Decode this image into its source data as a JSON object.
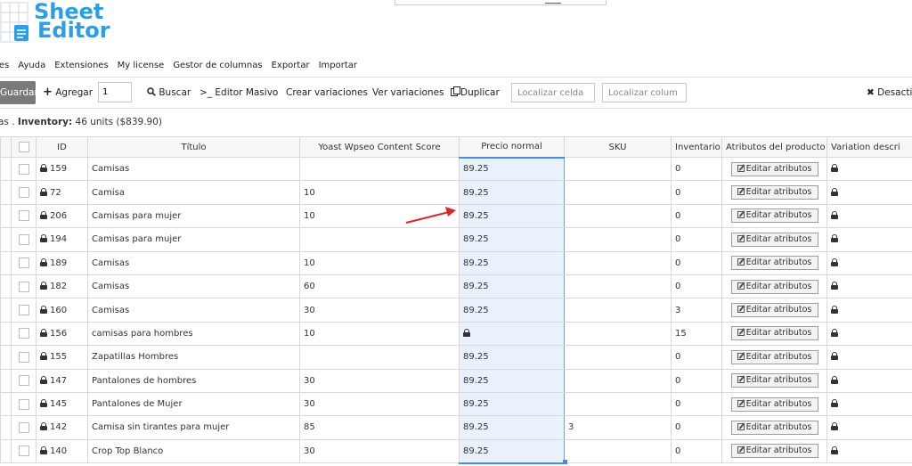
{
  "logo": {
    "line1": "Sheet",
    "line2": "Editor"
  },
  "menu": [
    "tes",
    "Ayuda",
    "Extensiones",
    "My license",
    "Gestor de columnas",
    "Exportar",
    "Importar"
  ],
  "toolbar": {
    "save_label": "Guardar",
    "add_label": "Agregar",
    "add_count": "1",
    "search_label": "Buscar",
    "bulk_edit_label": "Editor Masivo",
    "create_variations_label": "Crear variaciones",
    "view_variations_label": "Ver variaciones",
    "duplicate_label": "Duplicar",
    "find_cell_placeholder": "Localizar celda",
    "find_column_placeholder": "Localizar colum",
    "deactivate_label": "Desactiv"
  },
  "summary": {
    "prefix": "as . ",
    "inventory_label": "Inventory:",
    "inventory_value": " 46 units ($839.90)"
  },
  "columns": {
    "id": "ID",
    "title": "Título",
    "yoast": "Yoast Wpseo Content Score",
    "price": "Precio normal",
    "sku": "SKU",
    "inventory": "Inventario",
    "attributes": "Atributos del producto",
    "variation": "Variation descri"
  },
  "edit_attr_label": "Editar atributos",
  "rows": [
    {
      "id": "159",
      "title": "Camisas",
      "yoast": "",
      "price": "89.25",
      "sku": "",
      "inventory": "0"
    },
    {
      "id": "72",
      "title": "Camisa",
      "yoast": "10",
      "price": "89.25",
      "sku": "",
      "inventory": "0"
    },
    {
      "id": "206",
      "title": "Camisas para mujer",
      "yoast": "10",
      "price": "89.25",
      "sku": "",
      "inventory": "0"
    },
    {
      "id": "194",
      "title": "Camisas para mujer",
      "yoast": "",
      "price": "89.25",
      "sku": "",
      "inventory": "0"
    },
    {
      "id": "189",
      "title": "Camisas",
      "yoast": "10",
      "price": "89.25",
      "sku": "",
      "inventory": "0"
    },
    {
      "id": "182",
      "title": "Camisas",
      "yoast": "60",
      "price": "89.25",
      "sku": "",
      "inventory": "0"
    },
    {
      "id": "160",
      "title": "Camisas",
      "yoast": "30",
      "price": "89.25",
      "sku": "",
      "inventory": "3"
    },
    {
      "id": "156",
      "title": "camisas para hombres",
      "yoast": "10",
      "price": "",
      "price_locked": true,
      "sku": "",
      "inventory": "15"
    },
    {
      "id": "155",
      "title": "Zapatillas Hombres",
      "yoast": "",
      "price": "89.25",
      "sku": "",
      "inventory": "0"
    },
    {
      "id": "147",
      "title": "Pantalones de hombres",
      "yoast": "30",
      "price": "89.25",
      "sku": "",
      "inventory": "0"
    },
    {
      "id": "145",
      "title": "Pantalones de Mujer",
      "yoast": "30",
      "price": "89.25",
      "sku": "",
      "inventory": "0"
    },
    {
      "id": "142",
      "title": "Camisa sin tirantes para mujer",
      "yoast": "85",
      "price": "89.25",
      "sku": "3",
      "inventory": "0"
    },
    {
      "id": "140",
      "title": "Crop Top Blanco",
      "yoast": "30",
      "price": "89.25",
      "sku": "",
      "inventory": "0"
    }
  ],
  "colors": {
    "accent": "#2b9fe6",
    "selection": "#e9f1fd",
    "selection_border": "#4a8ae0",
    "arrow": "#d9282b"
  }
}
